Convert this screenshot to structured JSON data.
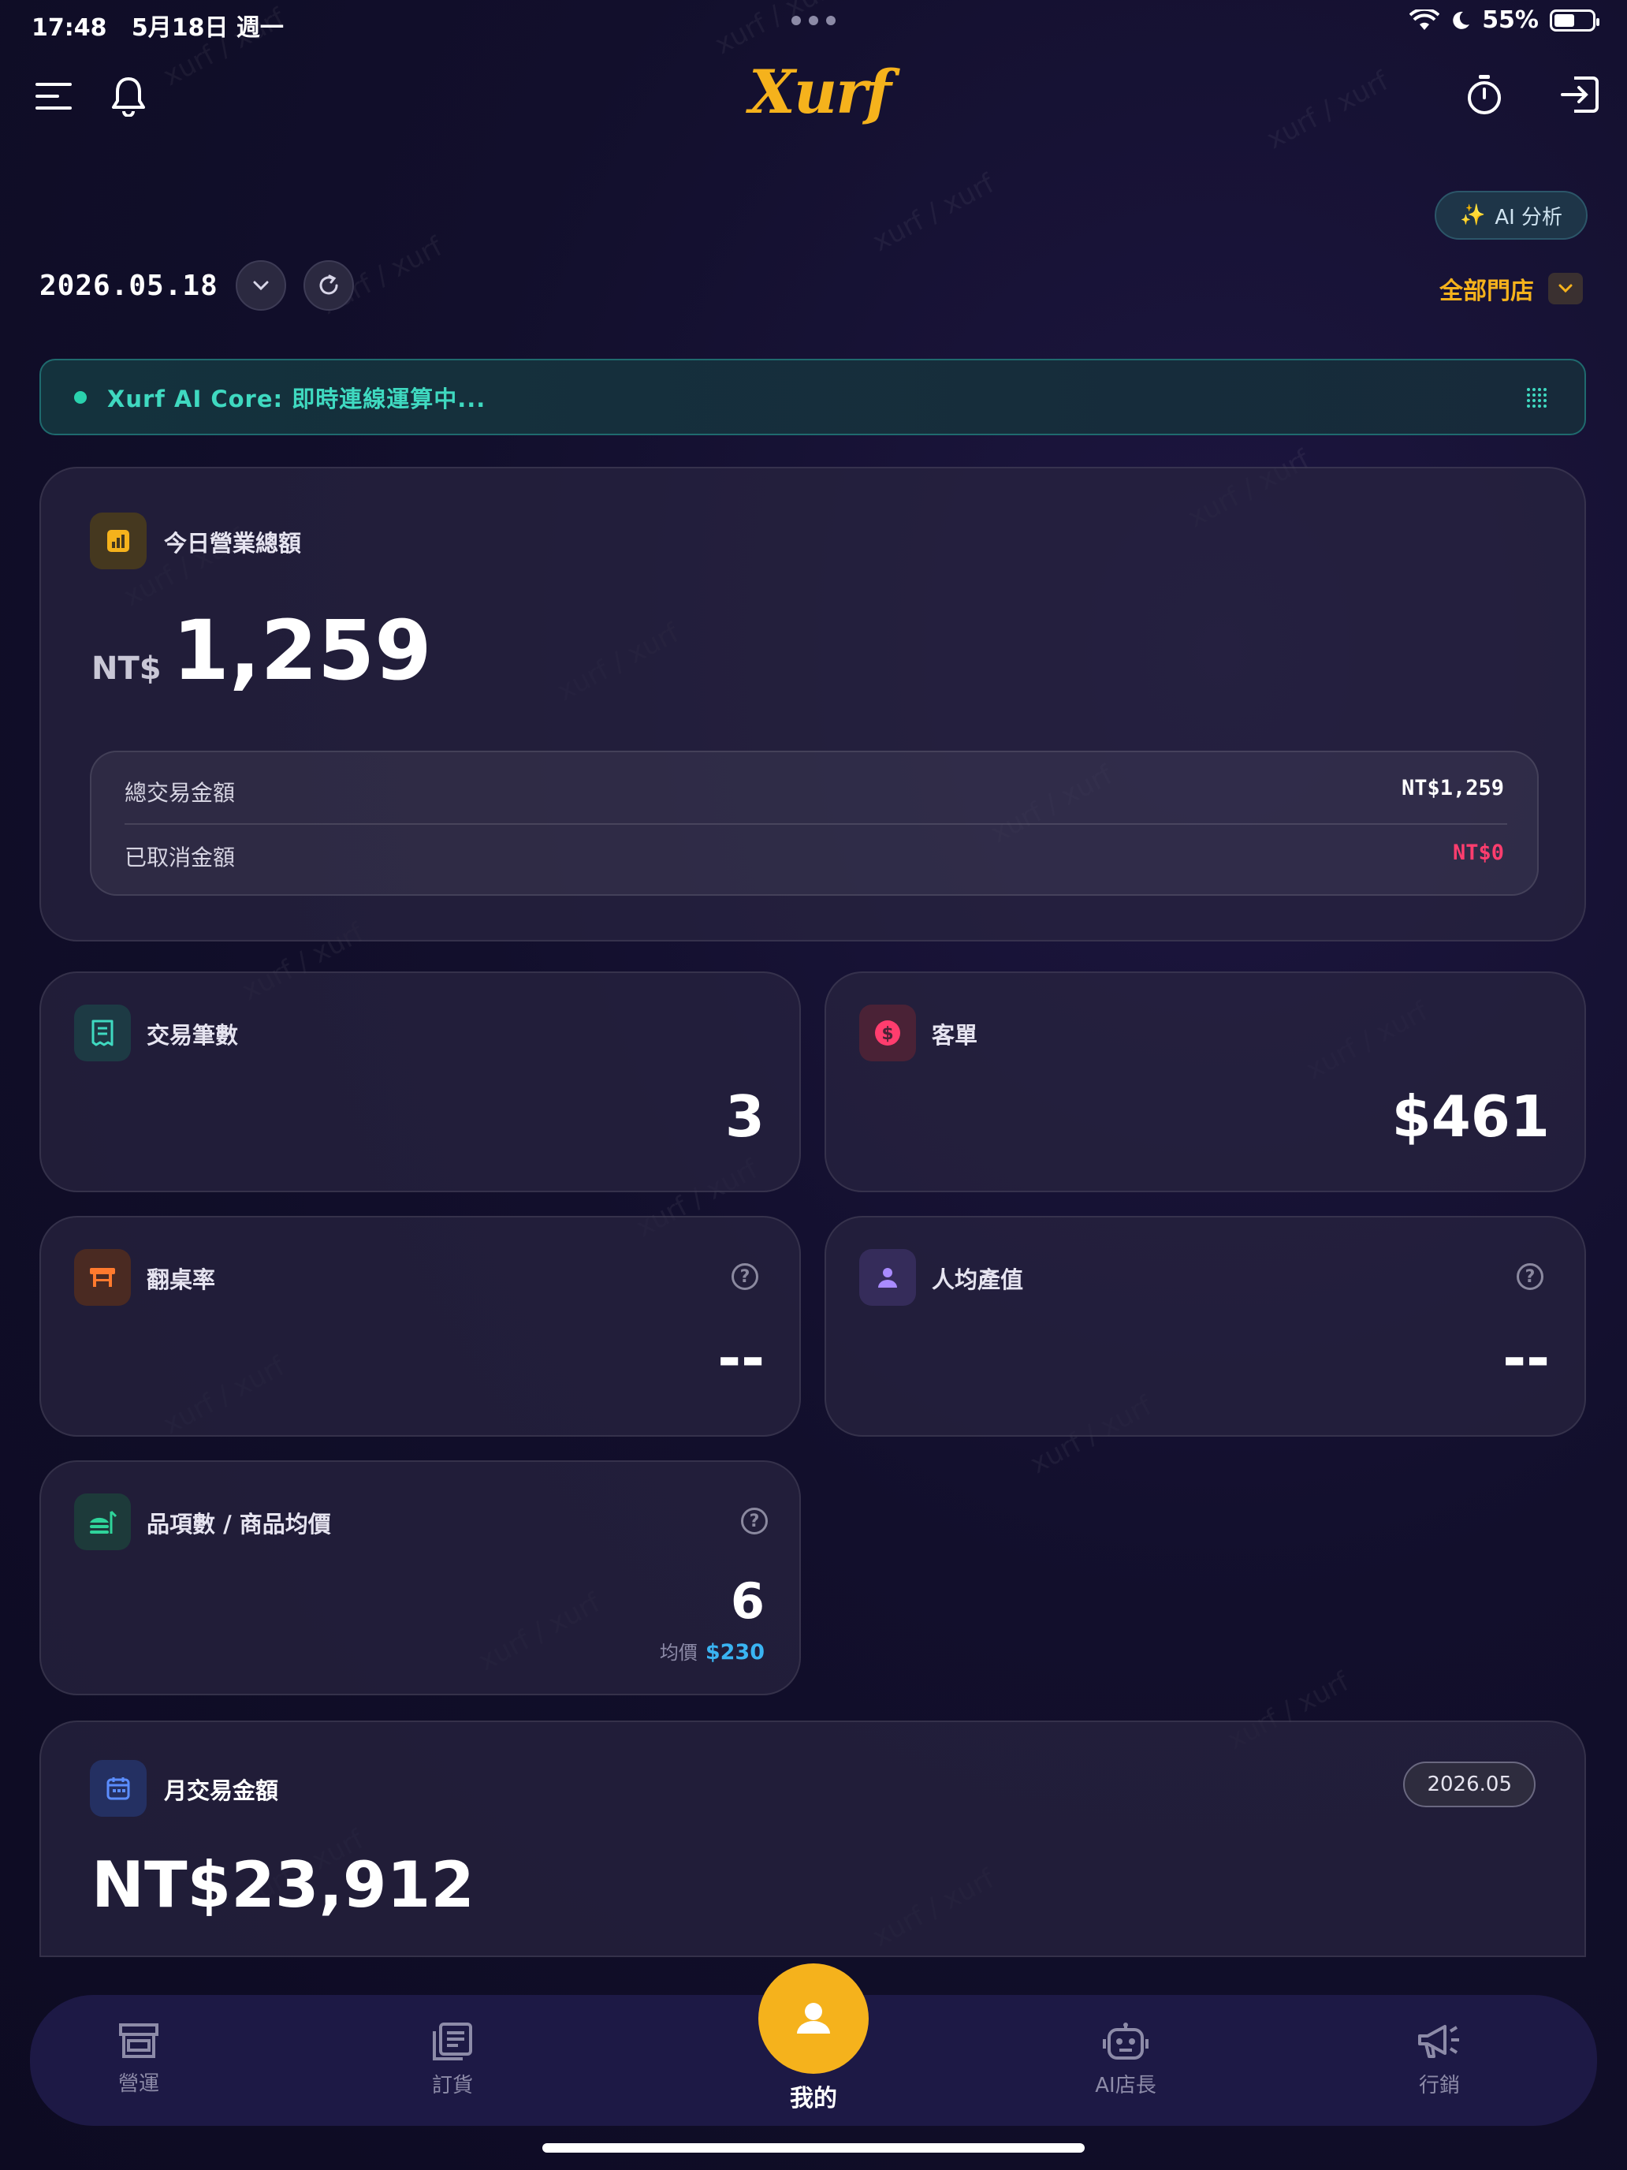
{
  "status_bar": {
    "time": "17:48",
    "date": "5月18日 週一",
    "battery": "55%",
    "battery_level": 0.55
  },
  "header": {
    "logo": "Xurf",
    "ai_button": "AI 分析"
  },
  "date_row": {
    "date": "2026.05.18",
    "store_label": "全部門店"
  },
  "banner": {
    "text": "Xurf AI Core: 即時連線運算中..."
  },
  "revenue": {
    "title": "今日營業總額",
    "currency": "NT$",
    "amount": "1,259",
    "rows": [
      {
        "label": "總交易金額",
        "value": "NT$1,259"
      },
      {
        "label": "已取消金額",
        "value": "NT$0"
      }
    ]
  },
  "stats": {
    "transactions": {
      "label": "交易筆數",
      "value": "3"
    },
    "avg_ticket": {
      "label": "客單",
      "value": "$461"
    },
    "turnover": {
      "label": "翻桌率",
      "value": "--"
    },
    "per_person": {
      "label": "人均產值",
      "value": "--"
    },
    "items": {
      "label": "品項數 / 商品均價",
      "value": "6",
      "avg_label": "均價",
      "avg_value": "$230"
    }
  },
  "monthly": {
    "label": "月交易金額",
    "badge": "2026.05",
    "value": "NT$23,912"
  },
  "nav": {
    "operations": "營運",
    "ordering": "訂貨",
    "me": "我的",
    "ai_manager": "AI店長",
    "marketing": "行銷"
  },
  "watermark": "xurf / xurf",
  "colors": {
    "accent": "#f5b21c",
    "teal": "#3fd9c0",
    "danger": "#ff3d6e",
    "link_blue": "#3ab4f2"
  }
}
